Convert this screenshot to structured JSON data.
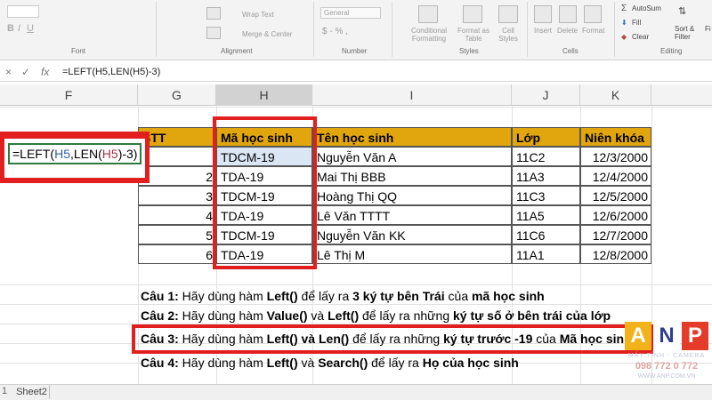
{
  "ribbon": {
    "groups": [
      "Font",
      "Alignment",
      "Number",
      "Styles",
      "Cells",
      "Editing"
    ],
    "wrap_text": "Wrap Text",
    "merge_center": "Merge & Center",
    "number_format": "General",
    "number_symbols": "$ - % ,",
    "conditional_formatting": "Conditional Formatting",
    "format_as_table": "Format as Table",
    "cell_styles": "Cell Styles",
    "insert": "Insert",
    "delete": "Delete",
    "format": "Format",
    "autosum": "AutoSum",
    "fill": "Fill",
    "clear": "Clear",
    "sort_filter": "Sort & Filter",
    "find": "Fi"
  },
  "formula_bar": {
    "cancel": "×",
    "enter": "✓",
    "fx": "fx",
    "formula": "=LEFT(H5,LEN(H5)-3)"
  },
  "columns": [
    "F",
    "G",
    "H",
    "I",
    "J",
    "K"
  ],
  "table": {
    "headers": [
      "STT",
      "Mã học sinh",
      "Tên học sinh",
      "Lớp",
      "Niên khóa"
    ],
    "rows": [
      {
        "stt": "",
        "ma": "TDCM-19",
        "ten": "Nguyễn Văn A",
        "lop": "11C2",
        "nien": "12/3/2000"
      },
      {
        "stt": "2",
        "ma": "TDA-19",
        "ten": "Mai Thị BBB",
        "lop": "11A3",
        "nien": "12/4/2000"
      },
      {
        "stt": "3",
        "ma": "TDCM-19",
        "ten": "Hoàng Thị QQ",
        "lop": "11C3",
        "nien": "12/5/2000"
      },
      {
        "stt": "4",
        "ma": "TDA-19",
        "ten": "Lê Văn TTTT",
        "lop": "11A5",
        "nien": "12/6/2000"
      },
      {
        "stt": "5",
        "ma": "TDCM-19",
        "ten": "Nguyễn Văn KK",
        "lop": "11C6",
        "nien": "12/7/2000"
      },
      {
        "stt": "6",
        "ma": "TDA-19",
        "ten": "Lê Thị M",
        "lop": "11A1",
        "nien": "12/8/2000"
      }
    ]
  },
  "formula_callout": {
    "prefix": "=LEFT(",
    "ref1": "H5",
    "mid": ",LEN(",
    "ref2": "H5",
    "suffix": ")-3)"
  },
  "questions": [
    {
      "label": "Câu 1:",
      "parts": [
        " Hãy dùng hàm ",
        "Left()",
        " để lấy ra ",
        "3 ký tự bên Trái",
        " của ",
        "mã học sinh"
      ]
    },
    {
      "label": "Câu 2:",
      "parts": [
        " Hãy dùng hàm ",
        "Value()",
        " và ",
        "Left()",
        " để lấy ra những ",
        "ký tự số ở bên trái của lớp"
      ]
    },
    {
      "label": "Câu 3:",
      "parts": [
        " Hãy dùng hàm ",
        "Left() và Len()",
        " để lấy ra  những ",
        "ký tự trước -19",
        " của ",
        "Mã học sinh"
      ]
    },
    {
      "label": "Câu 4:",
      "parts": [
        " Hãy dùng hàm ",
        "Left()",
        " và ",
        "Search()",
        " để lấy ra ",
        "Họ của học sinh"
      ]
    }
  ],
  "watermark": {
    "letters": [
      "A",
      "N",
      "P"
    ],
    "tagline": "MÁY TÍNH - CAMERA",
    "phone": "098 772 0 772",
    "site": "WWW.ANP.COM.VN"
  },
  "sheet_tabs": [
    "Sheet2"
  ],
  "row_hint": "1",
  "colors": {
    "header_fill": "#e1a60d",
    "highlight": "#e21f1f",
    "selected_cell": "#dbe6f4"
  }
}
